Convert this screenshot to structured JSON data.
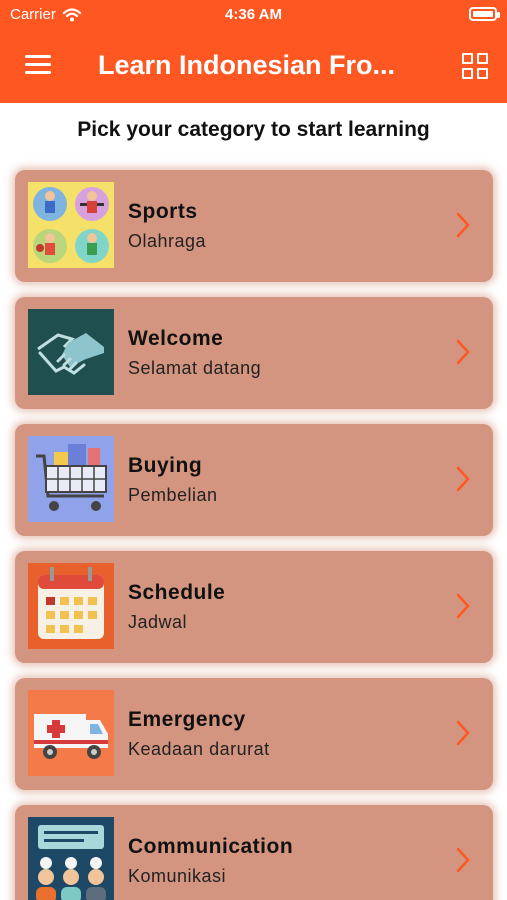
{
  "status_bar": {
    "carrier": "Carrier",
    "time": "4:36 AM"
  },
  "header": {
    "title": "Learn Indonesian Fro...",
    "accent_color": "#FF5722"
  },
  "subtitle": "Pick your category to start learning",
  "categories": [
    {
      "title": "Sports",
      "subtitle": "Olahraga",
      "icon": "sports-icon"
    },
    {
      "title": "Welcome",
      "subtitle": "Selamat datang",
      "icon": "handshake-icon"
    },
    {
      "title": "Buying",
      "subtitle": "Pembelian",
      "icon": "shopping-cart-icon"
    },
    {
      "title": "Schedule",
      "subtitle": "Jadwal",
      "icon": "calendar-icon"
    },
    {
      "title": "Emergency",
      "subtitle": "Keadaan darurat",
      "icon": "ambulance-icon"
    },
    {
      "title": "Communication",
      "subtitle": "Komunikasi",
      "icon": "chat-people-icon"
    }
  ],
  "colors": {
    "card": "#D49580",
    "chevron": "#FF5722"
  }
}
